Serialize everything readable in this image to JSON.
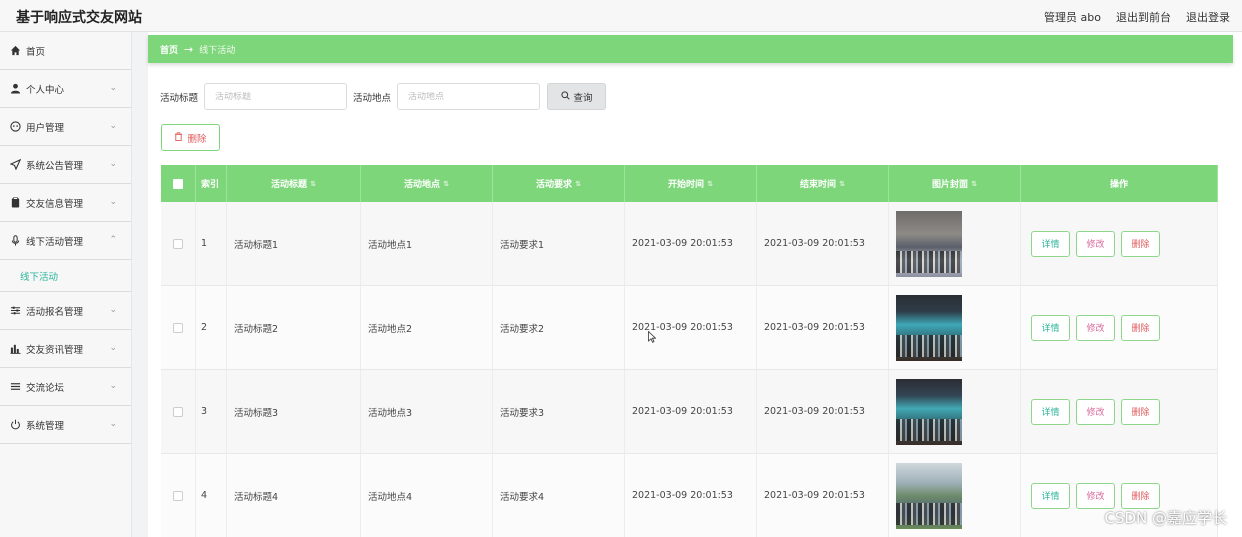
{
  "header": {
    "site_title": "基于响应式交友网站",
    "admin_label": "管理员 abo",
    "exit_front_label": "退出到前台",
    "logout_label": "退出登录"
  },
  "sidebar": {
    "items": [
      {
        "label": "首页",
        "icon": "home-icon",
        "expandable": false
      },
      {
        "label": "个人中心",
        "icon": "user-icon",
        "expandable": true
      },
      {
        "label": "用户管理",
        "icon": "users-circle-icon",
        "expandable": true
      },
      {
        "label": "系统公告管理",
        "icon": "send-icon",
        "expandable": true
      },
      {
        "label": "交友信息管理",
        "icon": "clipboard-icon",
        "expandable": true
      },
      {
        "label": "线下活动管理",
        "icon": "microphone-icon",
        "expandable": true,
        "expanded": true
      },
      {
        "label": "活动报名管理",
        "icon": "sliders-icon",
        "expandable": true
      },
      {
        "label": "交友资讯管理",
        "icon": "bar-chart-icon",
        "expandable": true
      },
      {
        "label": "交流论坛",
        "icon": "list-icon",
        "expandable": true
      },
      {
        "label": "系统管理",
        "icon": "power-icon",
        "expandable": true
      }
    ],
    "sub_item": "线下活动"
  },
  "breadcrumb": {
    "home": "首页",
    "current": "线下活动"
  },
  "search": {
    "title_label": "活动标题",
    "title_placeholder": "活动标题",
    "place_label": "活动地点",
    "place_placeholder": "活动地点",
    "query_label": "查询"
  },
  "toolbar": {
    "delete_label": "删除"
  },
  "table": {
    "headers": {
      "index": "索引",
      "title": "活动标题",
      "place": "活动地点",
      "requirement": "活动要求",
      "start": "开始时间",
      "end": "结束时间",
      "cover": "图片封面",
      "actions": "操作"
    },
    "rows": [
      {
        "index": "1",
        "title": "活动标题1",
        "place": "活动地点1",
        "requirement": "活动要求1",
        "start": "2021-03-09 20:01:53",
        "end": "2021-03-09 20:01:53"
      },
      {
        "index": "2",
        "title": "活动标题2",
        "place": "活动地点2",
        "requirement": "活动要求2",
        "start": "2021-03-09 20:01:53",
        "end": "2021-03-09 20:01:53"
      },
      {
        "index": "3",
        "title": "活动标题3",
        "place": "活动地点3",
        "requirement": "活动要求3",
        "start": "2021-03-09 20:01:53",
        "end": "2021-03-09 20:01:53"
      },
      {
        "index": "4",
        "title": "活动标题4",
        "place": "活动地点4",
        "requirement": "活动要求4",
        "start": "2021-03-09 20:01:53",
        "end": "2021-03-09 20:01:53"
      }
    ],
    "actions": {
      "detail": "详情",
      "edit": "修改",
      "delete": "删除"
    }
  },
  "watermark": "CSDN @嘉应学长",
  "colors": {
    "accent_green": "#7ed67b",
    "link_teal": "#2bb49a",
    "danger_red": "#e05a5a"
  }
}
